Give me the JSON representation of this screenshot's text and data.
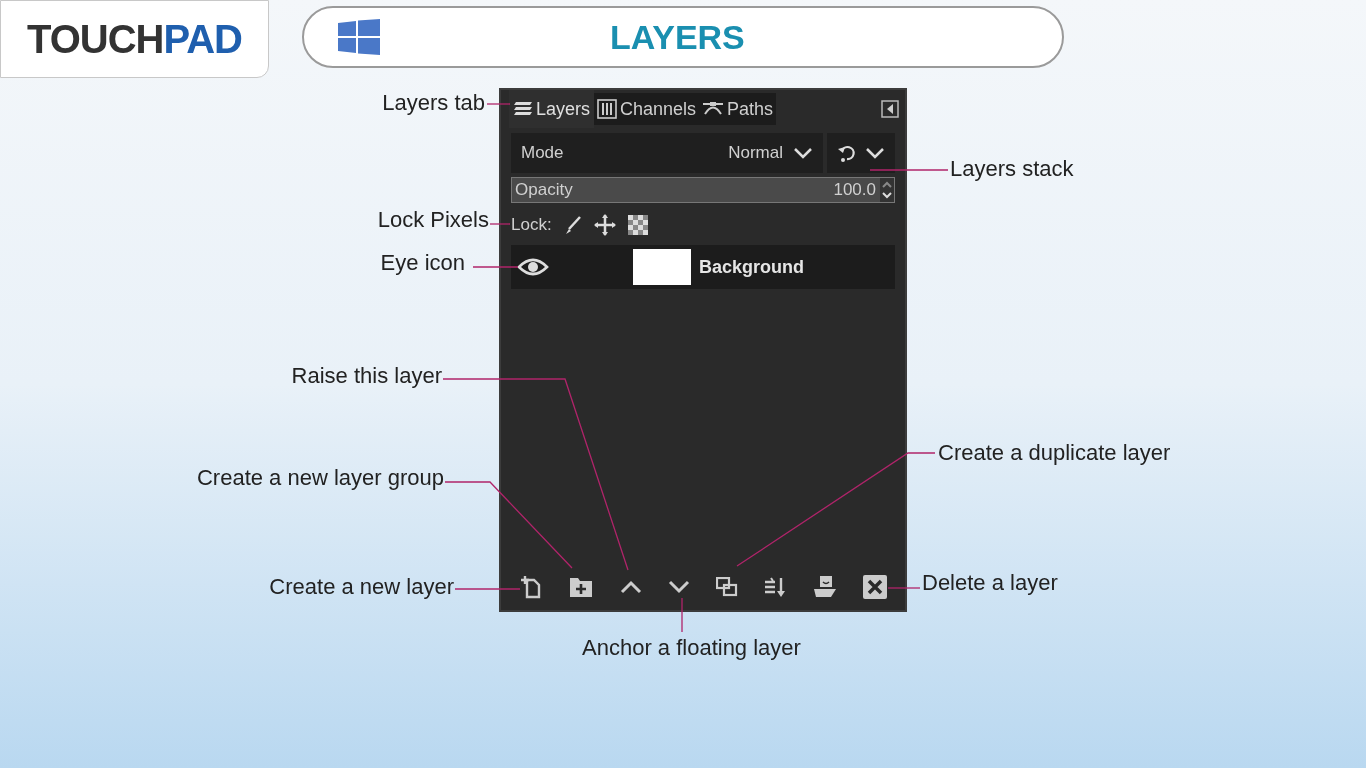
{
  "logo": {
    "part_1": "TOUCH",
    "part_2": "PAD"
  },
  "title": "LAYERS",
  "panel": {
    "tabs": [
      {
        "label": "Layers",
        "selected": true
      },
      {
        "label": "Channels",
        "selected": false
      },
      {
        "label": "Paths",
        "selected": false
      }
    ],
    "mode": {
      "label": "Mode",
      "value": "Normal"
    },
    "opacity": {
      "label": "Opacity",
      "value": "100.0"
    },
    "lock_label": "Lock:",
    "layers": [
      {
        "name": "Background",
        "visible": true
      }
    ]
  },
  "callouts": [
    {
      "text": "Layers tab"
    },
    {
      "text": "Layers stack"
    },
    {
      "text": "Lock Pixels"
    },
    {
      "text": "Eye icon"
    },
    {
      "text": "Raise this layer"
    },
    {
      "text": "Create a new layer group"
    },
    {
      "text": "Create a duplicate layer"
    },
    {
      "text": "Create a new layer"
    },
    {
      "text": "Delete a layer"
    },
    {
      "text": "Anchor a floating layer"
    }
  ]
}
